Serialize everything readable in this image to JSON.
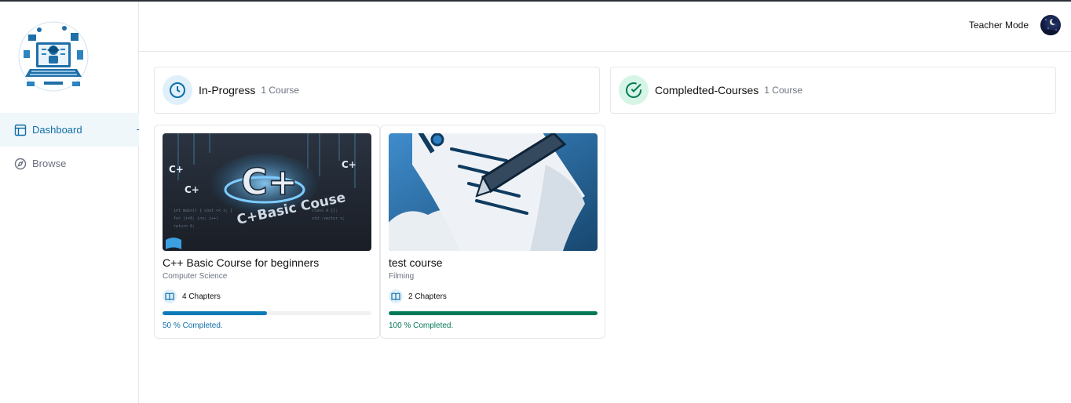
{
  "sidebar": {
    "logo": "laptop-education-logo",
    "items": [
      {
        "label": "Dashboard",
        "icon": "layout-icon",
        "active": true
      },
      {
        "label": "Browse",
        "icon": "compass-icon",
        "active": false
      }
    ]
  },
  "header": {
    "teacher_mode_label": "Teacher Mode",
    "avatar": "user-avatar"
  },
  "stats": {
    "in_progress": {
      "title": "In-Progress",
      "count": "1 Course",
      "icon": "clock-icon",
      "color": "#0f6ea8"
    },
    "completed": {
      "title": "Compledted-Courses",
      "count": "1 Course",
      "icon": "check-circle-icon",
      "color": "#047857"
    }
  },
  "courses": [
    {
      "title": "C++ Basic Course for beginners",
      "category": "Computer Science",
      "chapters": "4 Chapters",
      "progress": 0.5,
      "progress_text": "50 % Completed.",
      "progress_color": "#0f7ab8",
      "thumbnail_text": "C+Basic Couse",
      "thumbnail_logo": "C+"
    },
    {
      "title": "test course",
      "category": "Filming",
      "chapters": "2 Chapters",
      "progress": 1.0,
      "progress_text": "100 % Completed.",
      "progress_color": "#047857",
      "thumbnail_icon": "document-pen-icon"
    }
  ]
}
